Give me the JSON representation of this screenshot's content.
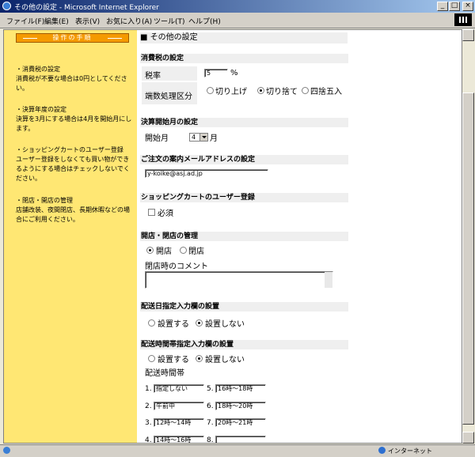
{
  "window": {
    "title": "その他の設定 - Microsoft Internet Explorer",
    "btn_min": "_",
    "btn_max": "□",
    "btn_close": "×"
  },
  "menu": [
    "ファイル(F)",
    "編集(E)",
    "表示(V)",
    "お気に入り(A)",
    "ツール(T)",
    "ヘルプ(H)"
  ],
  "sidebar": {
    "nav_title": "操作の手順",
    "tips": [
      {
        "title": "・消費税の設定",
        "body": "消費税が不要な場合は0円としてください。"
      },
      {
        "title": "・決算年度の設定",
        "body": "決算を3月にする場合は4月を開始月にします。"
      },
      {
        "title": "・ショッピングカートのユーザー登録",
        "body": "ユーザー登録をしなくても買い物ができるようにする場合はチェックしないでください。"
      },
      {
        "title": "・閉店・開店の管理",
        "body": "店舗改装、夜間閉店、長期休暇などの場合にご利用ください。"
      }
    ]
  },
  "page": {
    "title": "■ その他の設定",
    "tax": {
      "heading": "消費税の設定",
      "rate_label": "税率",
      "rate_value": "5",
      "rate_unit": "%",
      "rounding_label": "端数処理区分",
      "rounding_options": [
        "切り上げ",
        "切り捨て",
        "四捨五入"
      ],
      "rounding_selected": 1
    },
    "fiscal": {
      "heading": "決算開始月の設定",
      "label": "開始月",
      "value": "4",
      "unit": "月"
    },
    "email": {
      "heading": "ご注文の案内メールアドレスの設定",
      "value": "y-koike@asj.ad.jp"
    },
    "cart": {
      "heading": "ショッピングカートのユーザー登録",
      "checkbox_label": "必須",
      "checked": false
    },
    "store": {
      "heading": "開店・閉店の管理",
      "options": [
        "開店",
        "閉店"
      ],
      "selected": 0,
      "comment_label": "閉店時のコメント"
    },
    "delivery_date": {
      "heading": "配送日指定入力欄の設置",
      "options": [
        "設置する",
        "設置しない"
      ],
      "selected": 1
    },
    "delivery_time": {
      "heading": "配送時間帯指定入力欄の設置",
      "options": [
        "設置する",
        "設置しない"
      ],
      "selected": 1,
      "slots_label": "配送時間帯",
      "slots": [
        {
          "num": "1.",
          "value": "指定しない"
        },
        {
          "num": "2.",
          "value": "午前中"
        },
        {
          "num": "3.",
          "value": "12時～14時"
        },
        {
          "num": "4.",
          "value": "14時～16時"
        },
        {
          "num": "5.",
          "value": "16時～18時"
        },
        {
          "num": "6.",
          "value": "18時～20時"
        },
        {
          "num": "7.",
          "value": "20時～21時"
        },
        {
          "num": "8.",
          "value": ""
        }
      ]
    }
  },
  "status": {
    "zone": "インターネット"
  }
}
